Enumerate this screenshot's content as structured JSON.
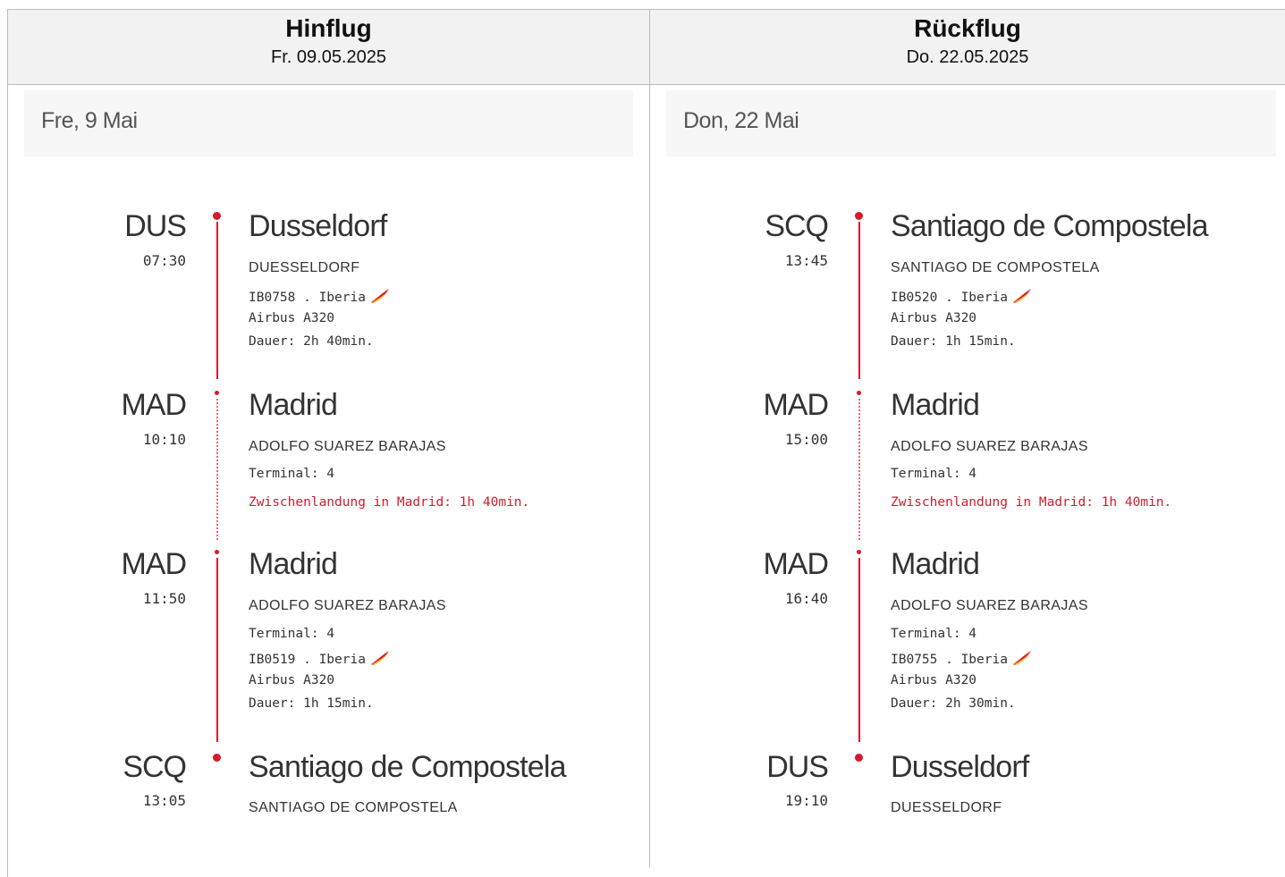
{
  "outbound": {
    "heading": "Hinflug",
    "date": "Fr. 09.05.2025",
    "day_label": "Fre, 9 Mai",
    "stops": [
      {
        "code": "DUS",
        "time": "07:30",
        "city": "Dusseldorf",
        "airport": "DUESSELDORF",
        "lines": [
          "IB0758 . Iberia",
          "Airbus A320",
          "Dauer: 2h 40min."
        ]
      },
      {
        "code": "MAD",
        "time": "10:10",
        "city": "Madrid",
        "airport": "ADOLFO SUAREZ BARAJAS",
        "lines": [
          "Terminal: 4"
        ],
        "layover": "Zwischenlandung in Madrid: 1h 40min."
      },
      {
        "code": "MAD",
        "time": "11:50",
        "city": "Madrid",
        "airport": "ADOLFO SUAREZ BARAJAS",
        "lines": [
          "Terminal: 4",
          "IB0519 . Iberia",
          "Airbus A320",
          "Dauer: 1h 15min."
        ]
      },
      {
        "code": "SCQ",
        "time": "13:05",
        "city": "Santiago de Compostela",
        "airport": "SANTIAGO DE COMPOSTELA",
        "lines": []
      }
    ]
  },
  "return": {
    "heading": "Rückflug",
    "date": "Do. 22.05.2025",
    "day_label": "Don, 22 Mai",
    "stops": [
      {
        "code": "SCQ",
        "time": "13:45",
        "city": "Santiago de Compostela",
        "airport": "SANTIAGO DE COMPOSTELA",
        "lines": [
          "IB0520 . Iberia",
          "Airbus A320",
          "Dauer: 1h 15min."
        ]
      },
      {
        "code": "MAD",
        "time": "15:00",
        "city": "Madrid",
        "airport": "ADOLFO SUAREZ BARAJAS",
        "lines": [
          "Terminal: 4"
        ],
        "layover": "Zwischenlandung in Madrid: 1h 40min."
      },
      {
        "code": "MAD",
        "time": "16:40",
        "city": "Madrid",
        "airport": "ADOLFO SUAREZ BARAJAS",
        "lines": [
          "Terminal: 4",
          "IB0755 . Iberia",
          "Airbus A320",
          "Dauer: 2h 30min."
        ]
      },
      {
        "code": "DUS",
        "time": "19:10",
        "city": "Dusseldorf",
        "airport": "DUESSELDORF",
        "lines": []
      }
    ]
  },
  "icons": {
    "airline_logo": "iberia-logo-icon"
  },
  "colors": {
    "accent": "#d7192d",
    "header_bg": "#f2f2f2",
    "day_bar_bg": "#f7f7f7"
  }
}
